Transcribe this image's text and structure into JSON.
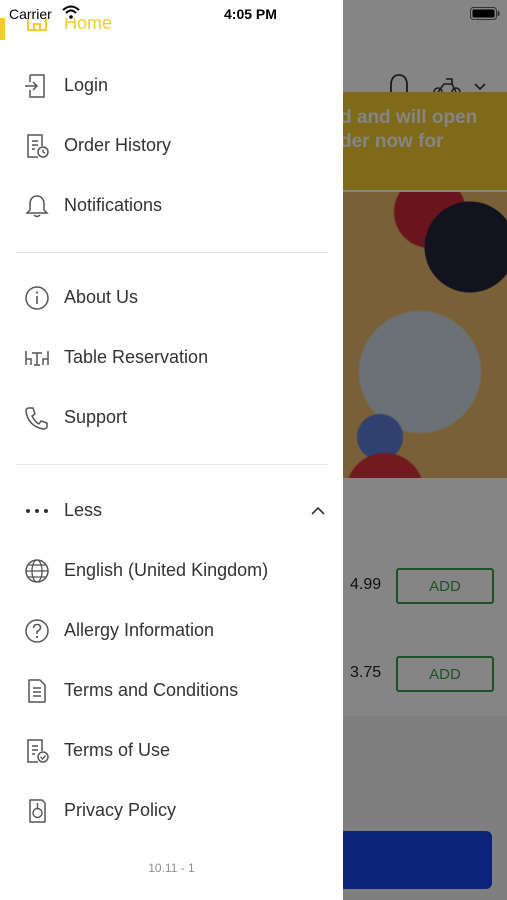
{
  "status_bar": {
    "carrier": "Carrier",
    "time": "4:05 PM"
  },
  "drawer": {
    "home_label": "Home",
    "group1": [
      {
        "label": "Login",
        "icon": "login-icon"
      },
      {
        "label": "Order History",
        "icon": "order-history-icon"
      },
      {
        "label": "Notifications",
        "icon": "bell-icon"
      }
    ],
    "group2": [
      {
        "label": "About Us",
        "icon": "info-icon"
      },
      {
        "label": "Table Reservation",
        "icon": "table-icon"
      },
      {
        "label": "Support",
        "icon": "phone-icon"
      }
    ],
    "more_toggle": {
      "label": "Less",
      "icon": "more-dots-icon"
    },
    "group3": [
      {
        "label": "English (United Kingdom)",
        "icon": "globe-icon"
      },
      {
        "label": "Allergy Information",
        "icon": "question-icon"
      },
      {
        "label": "Terms and Conditions",
        "icon": "document-icon"
      },
      {
        "label": "Terms of Use",
        "icon": "document-check-icon"
      },
      {
        "label": "Privacy Policy",
        "icon": "privacy-icon"
      }
    ],
    "version": "10.11 - 1",
    "accent_color": "#f2cc2f"
  },
  "background_app": {
    "banner_lines": [
      "d and will open",
      "der now for"
    ],
    "items": [
      {
        "price": "4.99",
        "add_label": "ADD"
      },
      {
        "price": "3.75",
        "add_label": "ADD"
      }
    ],
    "banner_color": "#f2cc2f",
    "add_color": "#3a9b4a",
    "cta_color": "#1646e8"
  }
}
